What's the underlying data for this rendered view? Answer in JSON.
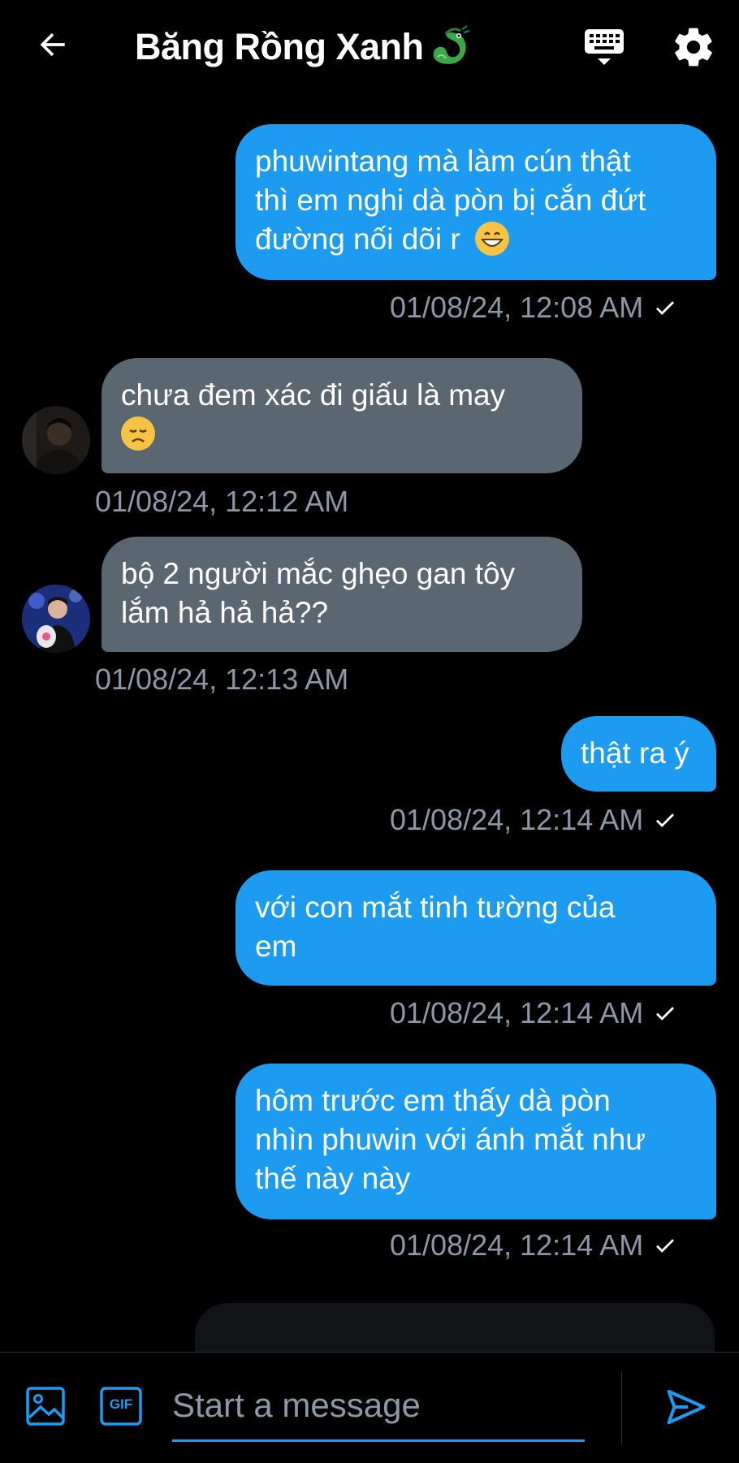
{
  "header": {
    "title": "Băng Rồng Xanh",
    "back_icon": "arrow-left-icon",
    "keyboard_icon": "keyboard-icon",
    "settings_icon": "gear-icon",
    "title_emoji": "dragon-emoji"
  },
  "messages": [
    {
      "direction": "outgoing",
      "lines": [
        "phuwintang mà làm cún thật",
        "thì em nghi dà pòn bị cắn đứt",
        "đường nối dõi r"
      ],
      "emoji": "grinning-face",
      "timestamp": "01/08/24, 12:08 AM",
      "status_icon": "check-icon"
    },
    {
      "direction": "incoming",
      "lines": [
        "chưa đem xác đi giấu là may"
      ],
      "emoji": "disappointed-face",
      "timestamp": "01/08/24, 12:12 AM",
      "avatar": "user-avatar-1"
    },
    {
      "direction": "incoming",
      "lines": [
        "bộ 2 người mắc ghẹo gan tôy",
        "lắm hả hả hả??"
      ],
      "timestamp": "01/08/24, 12:13 AM",
      "avatar": "user-avatar-2"
    },
    {
      "direction": "outgoing",
      "lines": [
        "thật ra ý"
      ],
      "timestamp": "01/08/24, 12:14 AM",
      "status_icon": "check-icon"
    },
    {
      "direction": "outgoing",
      "lines": [
        "với con mắt tinh tường của",
        "em"
      ],
      "timestamp": "01/08/24, 12:14 AM",
      "status_icon": "check-icon"
    },
    {
      "direction": "outgoing",
      "lines": [
        "hôm trước em thấy dà pòn",
        "nhìn phuwin với ánh mắt như",
        "thế này này"
      ],
      "timestamp": "01/08/24, 12:14 AM",
      "status_icon": "check-icon"
    }
  ],
  "compose": {
    "placeholder": "Start a message",
    "image_icon": "image-icon",
    "gif_icon": "gif-icon",
    "gif_label": "GIF",
    "send_icon": "send-icon"
  },
  "colors": {
    "background": "#000000",
    "outgoing_bubble": "#1d9bf0",
    "incoming_bubble": "#5b6770",
    "timestamp": "#8b98a5",
    "accent": "#1d9bf0"
  }
}
